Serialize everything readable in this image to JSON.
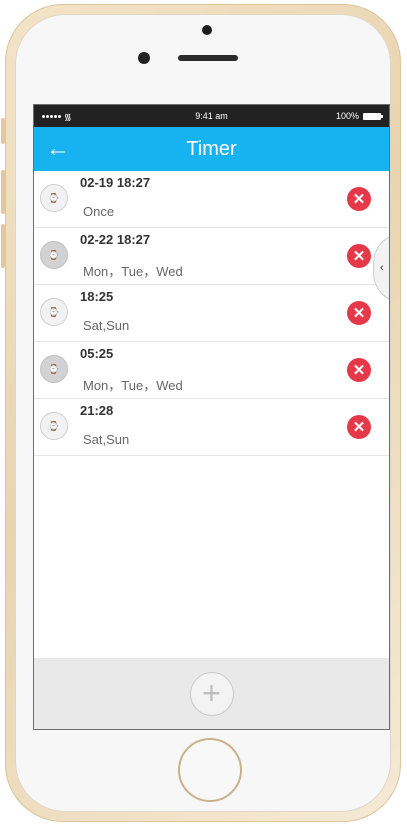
{
  "status_bar": {
    "time": "9:41 am",
    "battery": "100%",
    "wifi_icon": "wifi-icon"
  },
  "nav": {
    "back_icon": "←",
    "title": "Timer"
  },
  "timers": [
    {
      "time": "02-19 18:27",
      "repeat": "Once",
      "state": "off"
    },
    {
      "time": "02-22 18:27",
      "repeat": "Mon，Tue，Wed",
      "state": "on"
    },
    {
      "time": "18:25",
      "repeat": "Sat,Sun",
      "state": "off"
    },
    {
      "time": "05:25",
      "repeat": "Mon，Tue，Wed",
      "state": "on"
    },
    {
      "time": "21:28",
      "repeat": "Sat,Sun",
      "state": "off"
    }
  ],
  "icons": {
    "delete": "✕",
    "side_tab": "‹",
    "add": "+",
    "timer_glyph": "⌚"
  },
  "colors": {
    "accent": "#17b2f0",
    "delete": "#e5394a"
  }
}
